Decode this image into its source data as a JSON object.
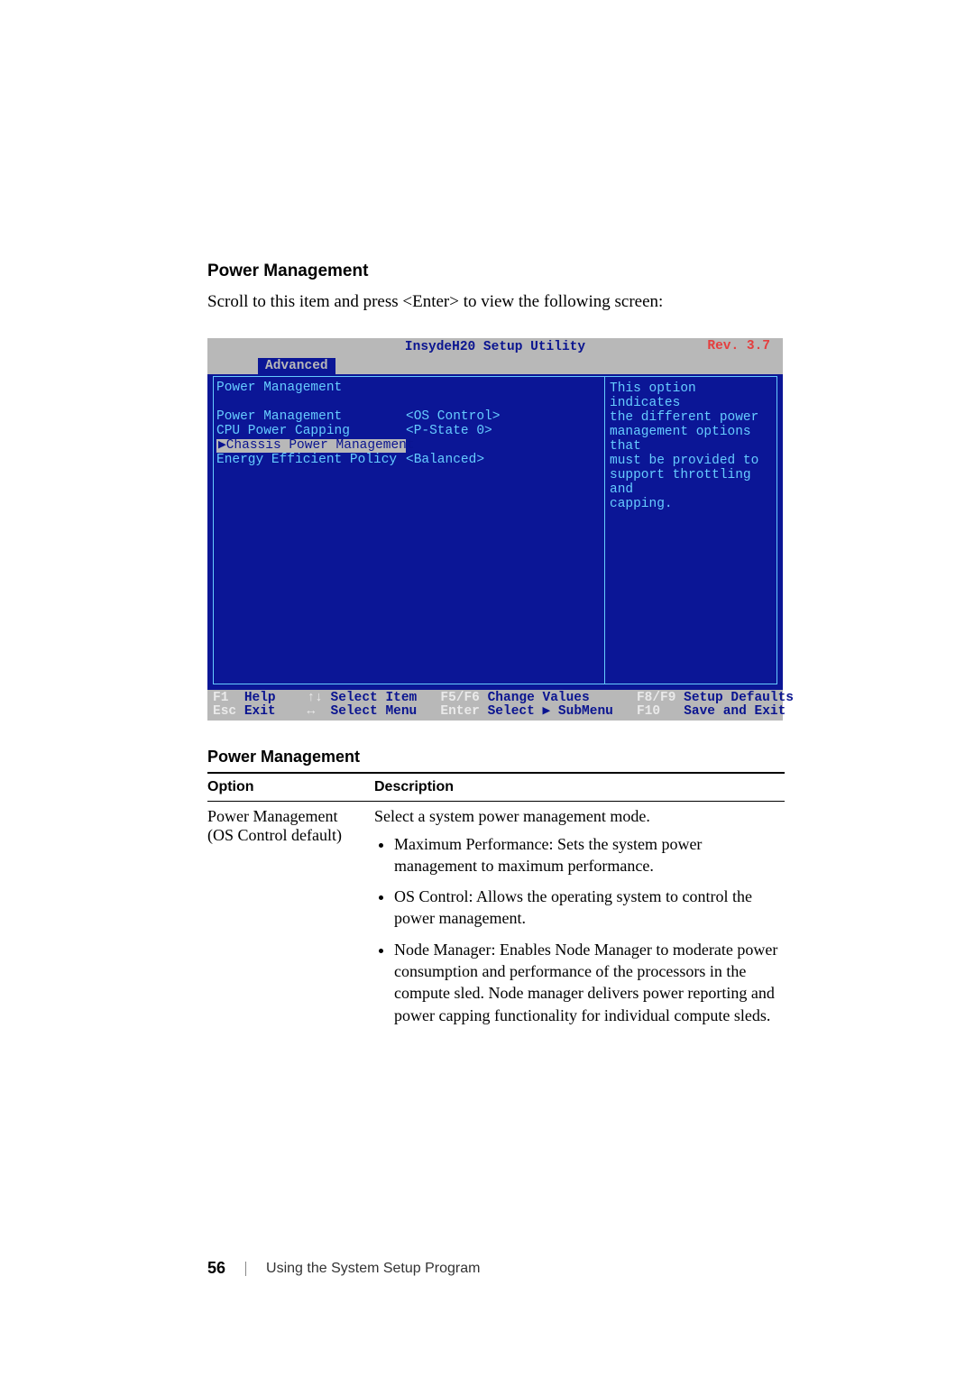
{
  "section_heading": "Power Management",
  "intro_text": "Scroll to this item and press <Enter> to view the following screen:",
  "bios": {
    "title": "InsydeH20 Setup Utility",
    "rev": "Rev. 3.7",
    "tab": "Advanced",
    "heading": "Power Management",
    "items": [
      {
        "label": "Power Management",
        "value": "<OS Control>",
        "selected": false
      },
      {
        "label": "CPU Power Capping",
        "value": "<P-State 0>",
        "selected": false
      },
      {
        "label": "▶Chassis Power Management",
        "value": "",
        "selected": true
      },
      {
        "label": "Energy Efficient Policy",
        "value": "<Balanced>",
        "selected": false
      }
    ],
    "help_text": "This option indicates\nthe different power\nmanagement options that\nmust be provided to\nsupport throttling and\ncapping.",
    "footer": {
      "row1": [
        {
          "key": "F1",
          "label": "Help"
        },
        {
          "key": "↑↓",
          "label": "Select Item"
        },
        {
          "key": "F5/F6",
          "label": "Change Values"
        },
        {
          "key": "F8/F9",
          "label": "Setup Defaults"
        }
      ],
      "row2": [
        {
          "key": "Esc",
          "label": "Exit"
        },
        {
          "key": "↔",
          "label": "Select Menu"
        },
        {
          "key": "Enter",
          "label": "Select ▶ SubMenu"
        },
        {
          "key": "F10",
          "label": "Save and Exit"
        }
      ]
    }
  },
  "table": {
    "title": "Power Management",
    "headers": {
      "option": "Option",
      "description": "Description"
    },
    "row": {
      "option_line1": "Power Management",
      "option_line2": "(OS Control default)",
      "desc_lead": "Select a system power management mode.",
      "bullets": [
        "Maximum Performance: Sets the system power management to maximum performance.",
        "OS Control: Allows the operating system to control the power management.",
        "Node Manager: Enables Node Manager to moderate power consumption and performance of the processors in the compute sled. Node manager delivers power reporting and power capping functionality for individual compute sleds."
      ]
    }
  },
  "footer": {
    "page": "56",
    "text": "Using the System Setup Program"
  }
}
